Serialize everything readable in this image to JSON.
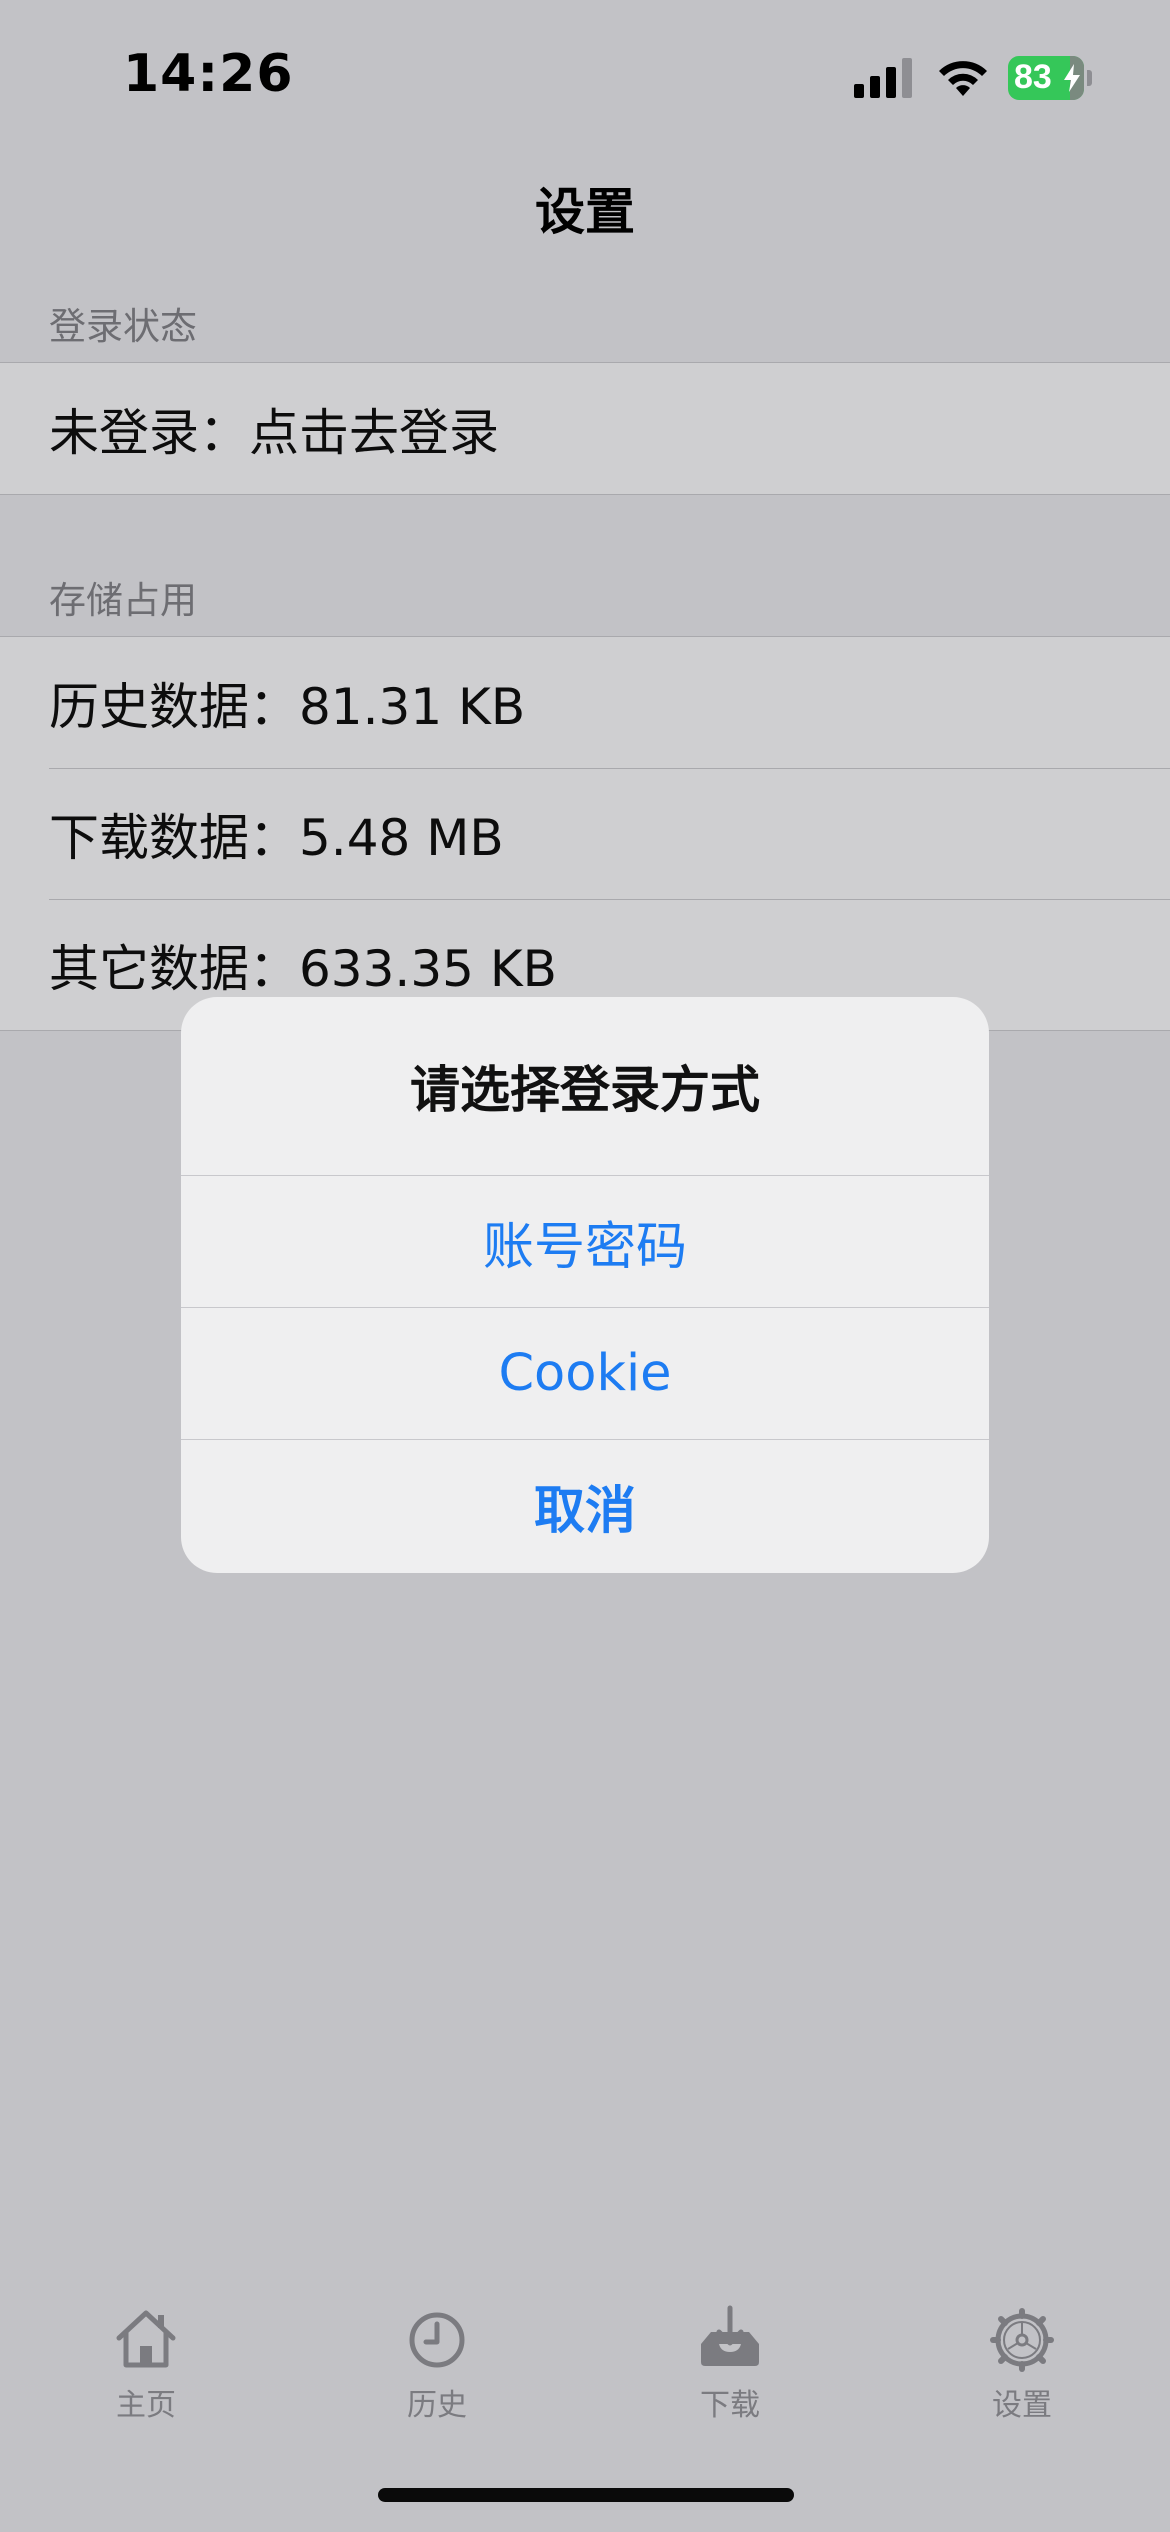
{
  "status_bar": {
    "time": "14:26",
    "battery_level": "83",
    "icons": [
      "signal-icon",
      "wifi-icon",
      "battery-charging-icon"
    ],
    "battery_color": "#35c759"
  },
  "nav": {
    "title": "设置"
  },
  "sections": [
    {
      "header": "登录状态",
      "rows": [
        "未登录：点击去登录"
      ]
    },
    {
      "header": "存储占用",
      "rows": [
        "历史数据：81.31 KB",
        "下载数据：5.48 MB",
        "其它数据：633.35 KB"
      ]
    }
  ],
  "alert": {
    "title": "请选择登录方式",
    "actions": [
      "账号密码",
      "Cookie",
      "取消"
    ],
    "action_color": "#1d7cf2"
  },
  "tab_bar": {
    "items": [
      {
        "label": "主页",
        "icon": "home-icon"
      },
      {
        "label": "历史",
        "icon": "clock-icon"
      },
      {
        "label": "下载",
        "icon": "download-tray-icon"
      },
      {
        "label": "设置",
        "icon": "gear-icon"
      }
    ]
  }
}
